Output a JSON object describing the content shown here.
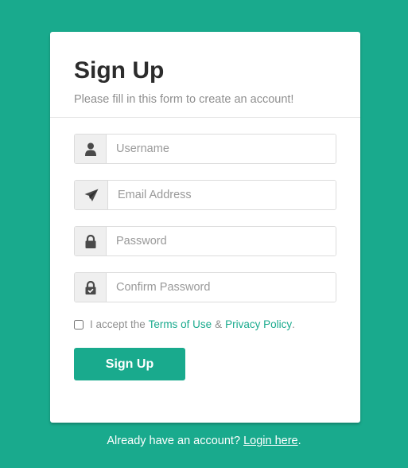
{
  "card": {
    "title": "Sign Up",
    "subtitle": "Please fill in this form to create an account!"
  },
  "form": {
    "fields": [
      {
        "name": "username",
        "icon": "user-icon",
        "placeholder": "Username",
        "value": ""
      },
      {
        "name": "email",
        "icon": "paper-plane-icon",
        "placeholder": "Email Address",
        "value": ""
      },
      {
        "name": "password",
        "icon": "lock-icon",
        "placeholder": "Password",
        "value": ""
      },
      {
        "name": "confirm_password",
        "icon": "lock-check-icon",
        "placeholder": "Confirm Password",
        "value": ""
      }
    ],
    "terms": {
      "checked": false,
      "prefix": "I accept the",
      "terms_link": "Terms of Use",
      "separator": "&",
      "privacy_link": "Privacy Policy",
      "suffix": "."
    },
    "submit_label": "Sign Up"
  },
  "footer": {
    "text": "Already have an account?",
    "login_link": "Login here",
    "suffix": "."
  },
  "colors": {
    "accent": "#19aa8d",
    "background": "#19aa8d",
    "title": "#2c2c2c",
    "muted": "#8f8f8f"
  }
}
